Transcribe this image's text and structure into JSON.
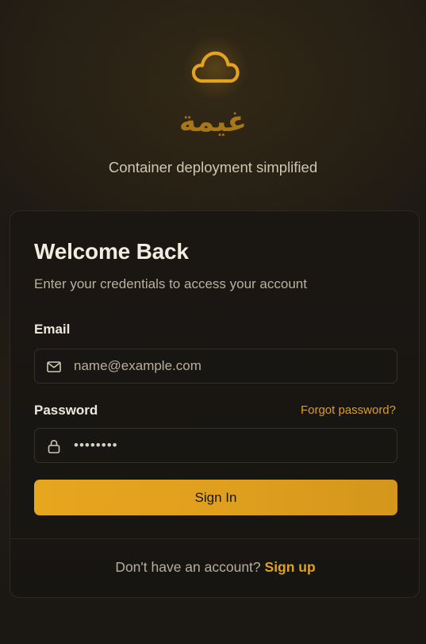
{
  "brand": {
    "logo_icon": "cloud-icon",
    "name": "غيمة",
    "tagline": "Container deployment simplified"
  },
  "login": {
    "title": "Welcome Back",
    "subtitle": "Enter your credentials to access your account",
    "email": {
      "label": "Email",
      "icon": "mail-icon",
      "placeholder": "name@example.com",
      "value": ""
    },
    "password": {
      "label": "Password",
      "icon": "lock-icon",
      "value": "••••••••",
      "forgot_label": "Forgot password?"
    },
    "submit_label": "Sign In",
    "signup_prompt": "Don't have an account?",
    "signup_link": "Sign up"
  },
  "colors": {
    "accent": "#e6a61e",
    "background": "#1d1913",
    "card": "#1a1713"
  }
}
